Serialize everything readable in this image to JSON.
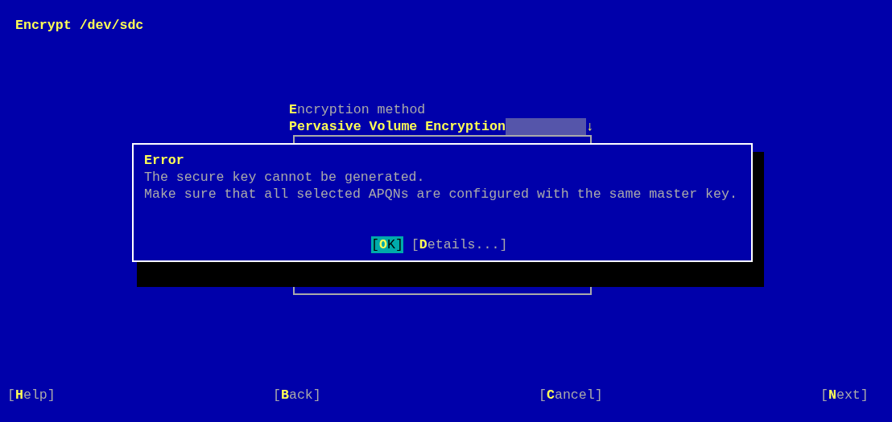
{
  "title": "Encrypt /dev/sdc",
  "encryption_method": {
    "label": "**E**ncryption method",
    "value": "Pervasive Volume Encryption",
    "arrow": "↓"
  },
  "dialog": {
    "title": "Error",
    "message": [
      "The secure key cannot be generated.",
      "Make sure that all selected APQNs are configured with the same master key."
    ],
    "buttons": [
      {
        "label": "[**O**K]",
        "selected": true
      },
      {
        "label": "[**D**etails...]",
        "selected": false
      }
    ]
  },
  "footer_buttons": [
    "[**H**elp]",
    "[**B**ack]",
    "[**C**ancel]",
    "[**N**ext]"
  ]
}
